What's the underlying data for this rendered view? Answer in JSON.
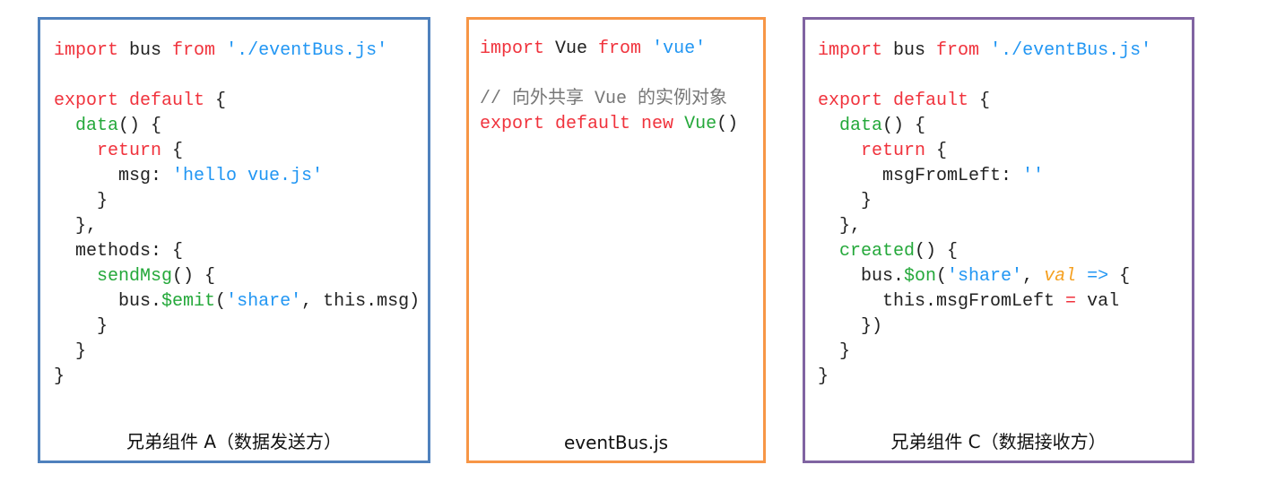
{
  "colors": {
    "panel_a_border": "#4f81bd",
    "panel_b_border": "#f79646",
    "panel_c_border": "#8064a2",
    "keyword": "#f0323c",
    "string": "#2196f3",
    "function": "#24a83a",
    "param": "#f5a021"
  },
  "panels": [
    {
      "caption": "兄弟组件 A（数据发送方）",
      "lines": [
        [
          [
            "import",
            "kw"
          ],
          [
            " bus ",
            "plain"
          ],
          [
            "from",
            "kw"
          ],
          [
            " ",
            "plain"
          ],
          [
            "'./eventBus.js'",
            "str"
          ]
        ],
        [],
        [
          [
            "export default",
            "kw"
          ],
          [
            " {",
            "plain"
          ]
        ],
        [
          [
            "  ",
            "plain"
          ],
          [
            "data",
            "fn"
          ],
          [
            "() {",
            "plain"
          ]
        ],
        [
          [
            "    ",
            "plain"
          ],
          [
            "return",
            "kw"
          ],
          [
            " {",
            "plain"
          ]
        ],
        [
          [
            "      msg: ",
            "plain"
          ],
          [
            "'hello vue.js'",
            "str"
          ]
        ],
        [
          [
            "    }",
            "plain"
          ]
        ],
        [
          [
            "  },",
            "plain"
          ]
        ],
        [
          [
            "  methods: {",
            "plain"
          ]
        ],
        [
          [
            "    ",
            "plain"
          ],
          [
            "sendMsg",
            "fn"
          ],
          [
            "() {",
            "plain"
          ]
        ],
        [
          [
            "      bus.",
            "plain"
          ],
          [
            "$emit",
            "fn"
          ],
          [
            "(",
            "plain"
          ],
          [
            "'share'",
            "str"
          ],
          [
            ", this.msg)",
            "plain"
          ]
        ],
        [
          [
            "    }",
            "plain"
          ]
        ],
        [
          [
            "  }",
            "plain"
          ]
        ],
        [
          [
            "}",
            "plain"
          ]
        ]
      ]
    },
    {
      "caption": "eventBus.js",
      "lines": [
        [
          [
            "import",
            "kw"
          ],
          [
            " Vue ",
            "plain"
          ],
          [
            "from",
            "kw"
          ],
          [
            " ",
            "plain"
          ],
          [
            "'vue'",
            "str"
          ]
        ],
        [],
        [
          [
            "// 向外共享 Vue 的实例对象",
            "cm"
          ]
        ],
        [
          [
            "export default new",
            "kw"
          ],
          [
            " ",
            "plain"
          ],
          [
            "Vue",
            "fn"
          ],
          [
            "()",
            "plain"
          ]
        ]
      ]
    },
    {
      "caption": "兄弟组件 C（数据接收方）",
      "lines": [
        [
          [
            "import",
            "kw"
          ],
          [
            " bus ",
            "plain"
          ],
          [
            "from",
            "kw"
          ],
          [
            " ",
            "plain"
          ],
          [
            "'./eventBus.js'",
            "str"
          ]
        ],
        [],
        [
          [
            "export default",
            "kw"
          ],
          [
            " {",
            "plain"
          ]
        ],
        [
          [
            "  ",
            "plain"
          ],
          [
            "data",
            "fn"
          ],
          [
            "() {",
            "plain"
          ]
        ],
        [
          [
            "    ",
            "plain"
          ],
          [
            "return",
            "kw"
          ],
          [
            " {",
            "plain"
          ]
        ],
        [
          [
            "      msgFromLeft: ",
            "plain"
          ],
          [
            "''",
            "str"
          ]
        ],
        [
          [
            "    }",
            "plain"
          ]
        ],
        [
          [
            "  },",
            "plain"
          ]
        ],
        [
          [
            "  ",
            "plain"
          ],
          [
            "created",
            "fn"
          ],
          [
            "() {",
            "plain"
          ]
        ],
        [
          [
            "    bus.",
            "plain"
          ],
          [
            "$on",
            "fn"
          ],
          [
            "(",
            "plain"
          ],
          [
            "'share'",
            "str"
          ],
          [
            ", ",
            "plain"
          ],
          [
            "val",
            "par"
          ],
          [
            " ",
            "plain"
          ],
          [
            "=>",
            "str"
          ],
          [
            " {",
            "plain"
          ]
        ],
        [
          [
            "      this.msgFromLeft ",
            "plain"
          ],
          [
            "=",
            "kw"
          ],
          [
            " val",
            "plain"
          ]
        ],
        [
          [
            "    })",
            "plain"
          ]
        ],
        [
          [
            "  }",
            "plain"
          ]
        ],
        [
          [
            "}",
            "plain"
          ]
        ]
      ]
    }
  ]
}
